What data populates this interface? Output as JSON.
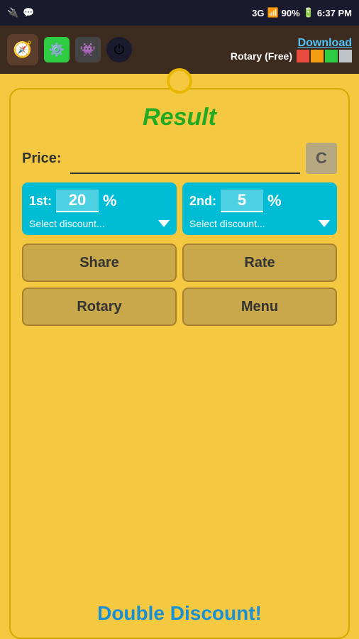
{
  "statusBar": {
    "signal1": "USB",
    "signal2": "3G",
    "battery": "90%",
    "time": "6:37 PM"
  },
  "topBar": {
    "downloadLabel": "Download",
    "appTitle": "Rotary (Free)"
  },
  "main": {
    "resultTitle": "Result",
    "priceLabel": "Price:",
    "priceValue": "",
    "pricePlaceholder": "",
    "clearBtn": "C",
    "discount1": {
      "label": "1st:",
      "value": "20",
      "pct": "%",
      "selectLabel": "Select discount..."
    },
    "discount2": {
      "label": "2nd:",
      "value": "5",
      "pct": "%",
      "selectLabel": "Select discount..."
    },
    "shareBtn": "Share",
    "rateBtn": "Rate",
    "rotaryBtn": "Rotary",
    "menuBtn": "Menu",
    "bottomLabel": "Double Discount!"
  },
  "colors": {
    "green": "#22aa22",
    "cyan": "#00bcd4",
    "blue": "#1a90d4",
    "gold": "#c8a84b",
    "tagBg": "#f5c842"
  }
}
